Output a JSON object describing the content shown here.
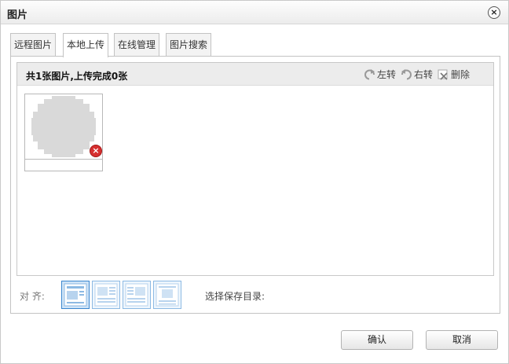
{
  "dialog": {
    "title": "图片",
    "close_label": "×"
  },
  "tabs": [
    {
      "label": "远程图片"
    },
    {
      "label": "本地上传"
    },
    {
      "label": "在线管理"
    },
    {
      "label": "图片搜索"
    }
  ],
  "active_tab": "本地上传",
  "upload": {
    "summary": "共1张图片,上传完成0张",
    "tools": {
      "rotate_left": "左转",
      "rotate_right": "右转",
      "delete": "删除"
    },
    "thumbnail": {
      "delete_label": "×"
    }
  },
  "footer_panel": {
    "align_label": "对 齐:",
    "align_options": [
      "none",
      "left",
      "right",
      "center"
    ],
    "selected_align": "none",
    "save_dir_label": "选择保存目录:"
  },
  "buttons": {
    "confirm": "确认",
    "cancel": "取消"
  },
  "colors": {
    "accent": "#5b9bd5",
    "delete": "#d62f2f",
    "header_bg": "#ececec"
  }
}
